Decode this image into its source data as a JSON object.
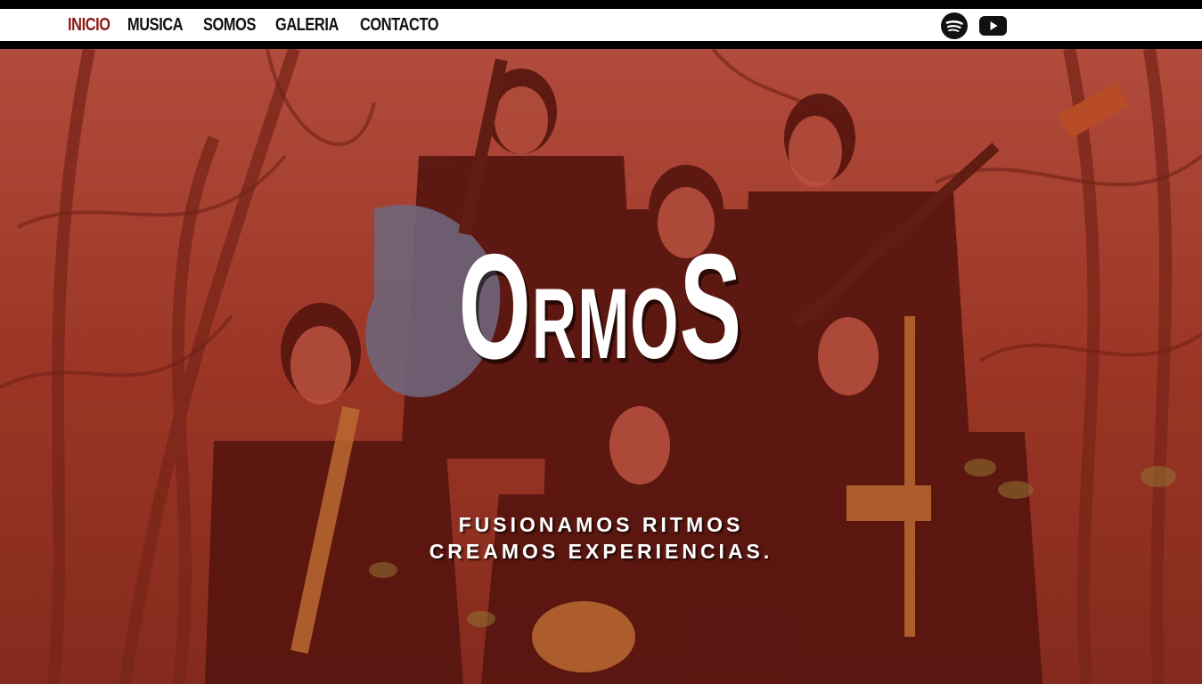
{
  "nav": {
    "items": [
      {
        "label": "INICIO",
        "active": true
      },
      {
        "label": "MUSICA",
        "active": false
      },
      {
        "label": "SOMOS",
        "active": false
      },
      {
        "label": "GALERIA",
        "active": false
      },
      {
        "label": "CONTACTO",
        "active": false
      }
    ],
    "active_color": "#8b1a14",
    "social": [
      {
        "icon": "spotify-icon"
      },
      {
        "icon": "youtube-icon"
      }
    ]
  },
  "hero": {
    "logo": {
      "part1": "O",
      "part2": "RMO",
      "part3": "S"
    },
    "tagline_line1": "FUSIONAMOS RITMOS",
    "tagline_line2": "CREAMOS EXPERIENCIAS.",
    "overlay_color": "#c8281e"
  }
}
